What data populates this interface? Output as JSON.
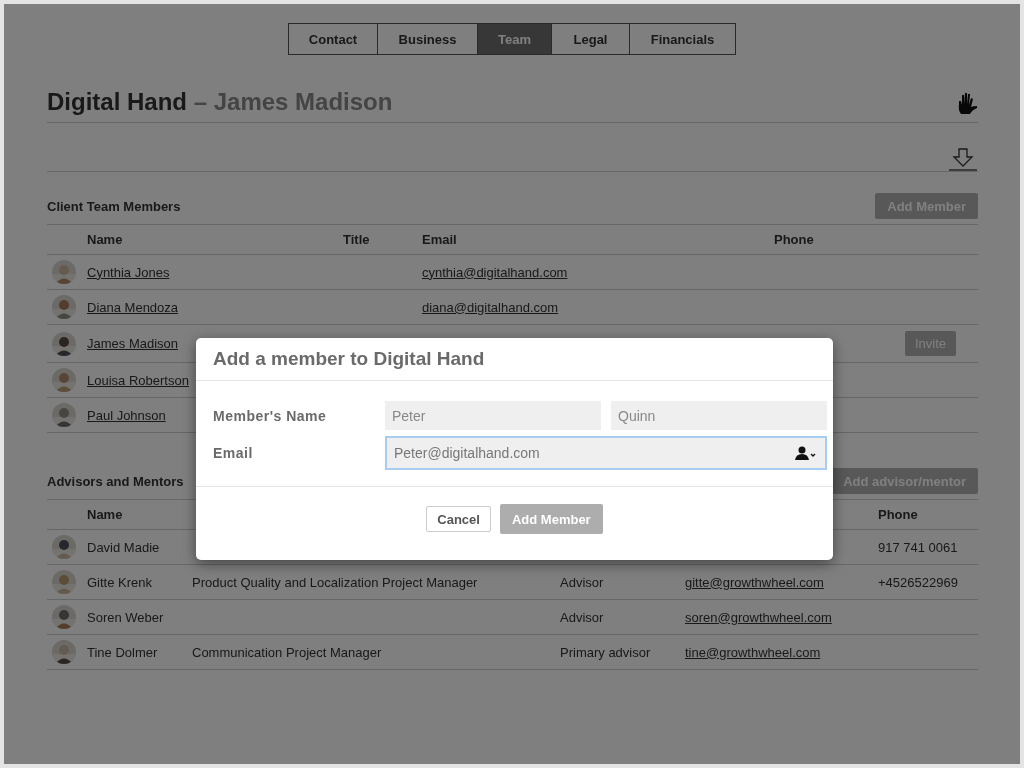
{
  "tabs": [
    {
      "label": "Contact",
      "selected": false
    },
    {
      "label": "Business",
      "selected": false
    },
    {
      "label": "Team",
      "selected": true
    },
    {
      "label": "Legal",
      "selected": false
    },
    {
      "label": "Financials",
      "selected": false
    }
  ],
  "title": {
    "company": "Digital Hand",
    "person": "– James Madison"
  },
  "client_team": {
    "heading": "Client Team Members",
    "add_button": "Add Member",
    "header": {
      "name": "Name",
      "title": "Title",
      "email": "Email",
      "phone": "Phone"
    },
    "rows": [
      {
        "name": "Cynthia Jones",
        "email": "cynthia@digitalhand.com"
      },
      {
        "name": "Diana Mendoza",
        "email": "diana@digitalhand.com"
      },
      {
        "name": "James Madison",
        "action": "Invite"
      },
      {
        "name": "Louisa Robertson"
      },
      {
        "name": "Paul Johnson"
      }
    ]
  },
  "advisors": {
    "heading": "Advisors and Mentors",
    "add_button": "Add advisor/mentor",
    "header": {
      "name": "Name",
      "phone": "Phone"
    },
    "rows": [
      {
        "name": "David Madie",
        "phone": "917 741 0061"
      },
      {
        "name": "Gitte Krenk",
        "title": "Product Quality and Localization Project Manager",
        "role": "Advisor",
        "email": "gitte@growthwheel.com",
        "phone": "+4526522969"
      },
      {
        "name": "Soren Weber",
        "role": "Advisor",
        "email": "soren@growthwheel.com"
      },
      {
        "name": "Tine Dolmer",
        "title": "Communication Project Manager",
        "role": "Primary advisor",
        "email": "tine@growthwheel.com"
      }
    ]
  },
  "dialog": {
    "title": "Add a member to Digital Hand",
    "name_label": "Member's Name",
    "first_name": "Peter",
    "last_name": "Quinn",
    "email_label": "Email",
    "email": "Peter@digitalhand.com",
    "email_focused": true,
    "cancel": "Cancel",
    "submit": "Add Member",
    "submit_disabled": true
  }
}
